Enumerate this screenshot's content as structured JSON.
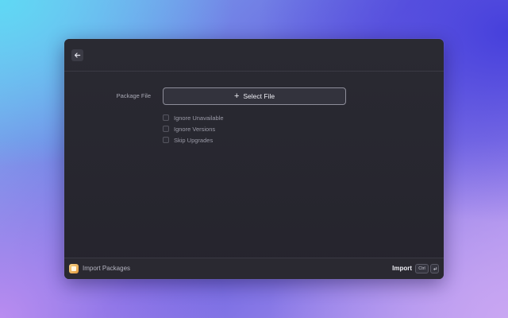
{
  "dialog": {
    "back_icon": "arrow-left-icon",
    "form": {
      "package_file_label": "Package File",
      "select_file_button": "Select File",
      "select_file_icon": "plus-icon",
      "options": [
        {
          "label": "Ignore Unavailable",
          "checked": false
        },
        {
          "label": "Ignore Versions",
          "checked": false
        },
        {
          "label": "Skip Upgrades",
          "checked": false
        }
      ]
    },
    "footer": {
      "app_icon": "package-app-icon",
      "title": "Import Packages",
      "action_label": "Import",
      "shortcut": {
        "modifier": "Ctrl",
        "key_icon": "return-icon"
      }
    }
  },
  "colors": {
    "window_bg": "#2a2a32",
    "button_border": "#8d8d99",
    "text_primary": "#ececf2",
    "text_secondary": "#a8a8b4",
    "app_icon_accent": "#e39a3c"
  }
}
